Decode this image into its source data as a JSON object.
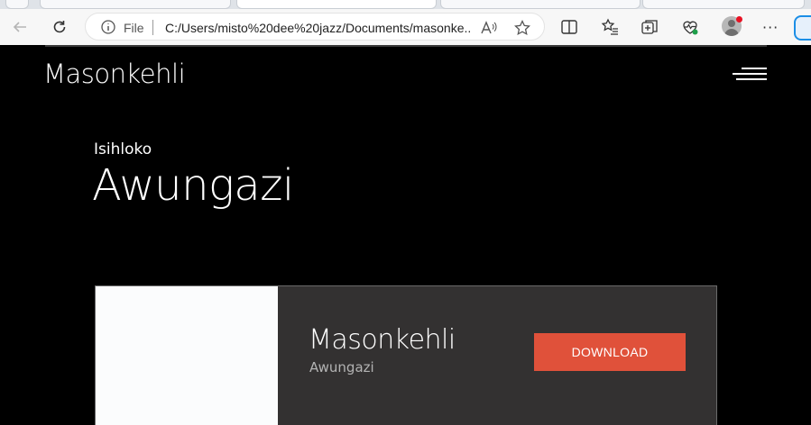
{
  "browser": {
    "address": {
      "scheme_label": "File",
      "url": "C:/Users/misto%20dee%20jazz/Documents/masonke..."
    },
    "icons": {
      "back": "arrow-left-icon",
      "refresh": "refresh-icon",
      "info": "info-icon",
      "read_aloud": "read-aloud-icon",
      "favorite": "star-icon",
      "split_screen": "split-screen-icon",
      "favorites": "favorites-list-icon",
      "collections": "collections-icon",
      "browser_essentials": "heart-pulse-icon",
      "profile": "profile-avatar",
      "more": "more-dots-icon",
      "copilot": "copilot-icon"
    },
    "more_label": "···"
  },
  "site": {
    "logo": "Masonkehli",
    "menu_icon": "hamburger-menu-icon"
  },
  "hero": {
    "kicker": "Isihloko",
    "title": "Awungazi"
  },
  "card": {
    "title": "Masonkehli",
    "subtitle": "Awungazi",
    "download_label": "DOWNLOAD"
  },
  "colors": {
    "page_bg": "#000000",
    "card_bg": "#333131",
    "accent": "#e0513a",
    "card_sub_text": "#b3b3b3"
  }
}
